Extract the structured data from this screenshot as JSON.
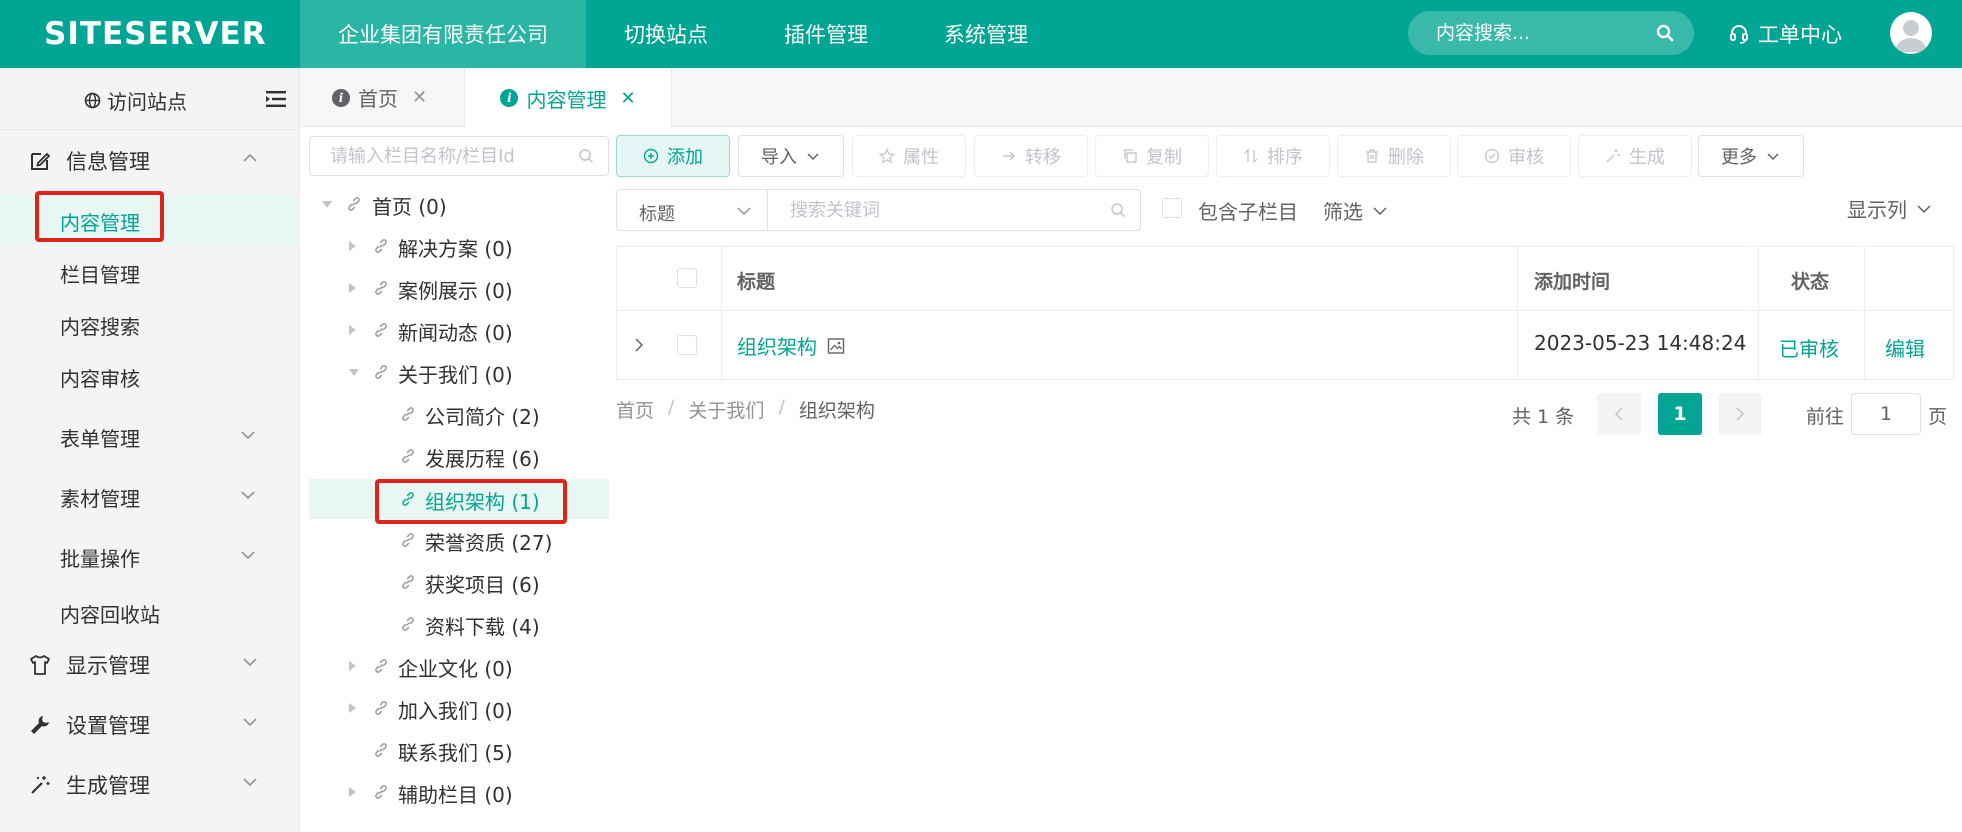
{
  "header": {
    "logo": "SITESERVER",
    "nav": [
      "企业集团有限责任公司",
      "切换站点",
      "插件管理",
      "系统管理"
    ],
    "search_placeholder": "内容搜索...",
    "ticket_label": "工单中心"
  },
  "sidebar": {
    "visit_label": "访问站点",
    "groups": {
      "info": "信息管理",
      "display": "显示管理",
      "settings": "设置管理",
      "generate": "生成管理"
    },
    "sub_items": [
      "内容管理",
      "栏目管理",
      "内容搜索",
      "内容审核",
      "表单管理",
      "素材管理",
      "批量操作",
      "内容回收站"
    ]
  },
  "tabs": [
    {
      "label": "首页"
    },
    {
      "label": "内容管理"
    }
  ],
  "tree": {
    "search_placeholder": "请输入栏目名称/栏目Id",
    "nodes": [
      "首页 (0)",
      "解决方案 (0)",
      "案例展示 (0)",
      "新闻动态 (0)",
      "关于我们 (0)",
      "公司简介 (2)",
      "发展历程 (6)",
      "组织架构 (1)",
      "荣誉资质 (27)",
      "获奖项目 (6)",
      "资料下载 (4)",
      "企业文化 (0)",
      "加入我们 (0)",
      "联系我们 (5)",
      "辅助栏目 (0)"
    ]
  },
  "toolbar": {
    "add": "添加",
    "import": "导入",
    "attr": "属性",
    "transfer": "转移",
    "copy": "复制",
    "sort": "排序",
    "delete": "删除",
    "audit": "审核",
    "generate": "生成",
    "more": "更多"
  },
  "filter": {
    "field_select": "标题",
    "keyword_placeholder": "搜索关键词",
    "include_children": "包含子栏目",
    "filter_label": "筛选",
    "columns_label": "显示列"
  },
  "table": {
    "headers": {
      "title": "标题",
      "added": "添加时间",
      "status": "状态"
    },
    "rows": [
      {
        "title": "组织架构",
        "added": "2023-05-23 14:48:24",
        "status": "已审核",
        "action": "编辑"
      }
    ]
  },
  "breadcrumb": [
    "首页",
    "关于我们",
    "组织架构"
  ],
  "pagination": {
    "total": "共 1 条",
    "current": "1",
    "goto_label": "前往",
    "goto_value": "1",
    "page_suffix": "页"
  },
  "colors": {
    "brand": "#00a693",
    "annotation": "#e2231a"
  }
}
